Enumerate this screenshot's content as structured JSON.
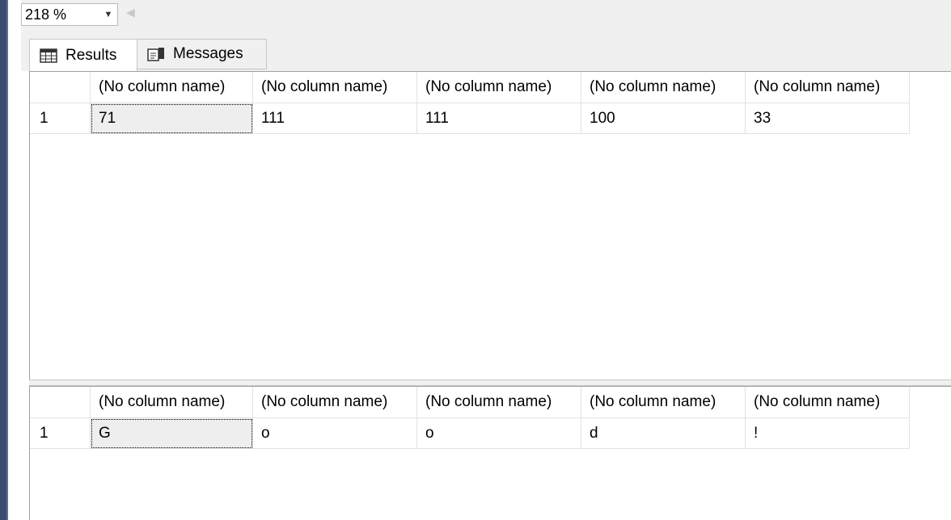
{
  "toolbar": {
    "zoom_value": "218 %",
    "zoom_dropdown_icon": "chevron-down-icon",
    "scroll_left_icon": "scroll-left-arrow-icon"
  },
  "tabs": [
    {
      "label": "Results",
      "icon": "grid-icon",
      "selected": true
    },
    {
      "label": "Messages",
      "icon": "messages-icon",
      "selected": false
    }
  ],
  "grids": [
    {
      "columns": [
        "(No column name)",
        "(No column name)",
        "(No column name)",
        "(No column name)",
        "(No column name)"
      ],
      "rows": [
        {
          "num": "1",
          "cells": [
            "71",
            "111",
            "111",
            "100",
            "33"
          ]
        }
      ]
    },
    {
      "columns": [
        "(No column name)",
        "(No column name)",
        "(No column name)",
        "(No column name)",
        "(No column name)"
      ],
      "rows": [
        {
          "num": "1",
          "cells": [
            "G",
            "o",
            "o",
            "d",
            "!"
          ]
        }
      ]
    }
  ],
  "colors": {
    "window_frame": "#3a4b6e",
    "toolbar_bg": "#f0f0f0",
    "grid_line": "#e2e2e2",
    "selected_cell_bg": "#eeeeee"
  }
}
